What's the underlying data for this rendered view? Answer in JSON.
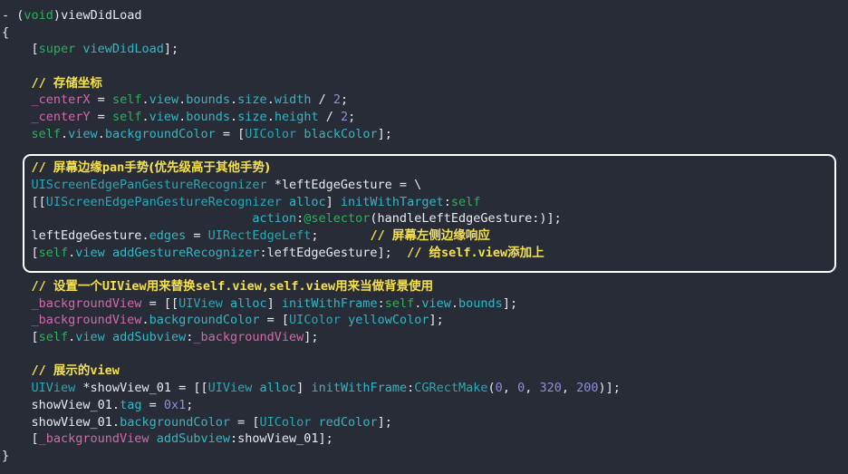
{
  "editor": {
    "language": "Objective-C",
    "background_color": "#282c36",
    "default_text_color": "#e8eaf0",
    "comment_color": "#f4e04d",
    "keyword_color": "#2fae5e",
    "type_color": "#2aa8b5",
    "property_color": "#36b5c4",
    "variable_color": "#d06aa8",
    "number_color": "#8f8ed8",
    "highlight_border_color": "#ffffff"
  },
  "code_lines": [
    {
      "id": "l1",
      "text": "- (void)viewDidLoad"
    },
    {
      "id": "l2",
      "text": "{"
    },
    {
      "id": "l3",
      "text": "    [super viewDidLoad];"
    },
    {
      "id": "l4",
      "text": ""
    },
    {
      "id": "l5",
      "text": "    // 存储坐标"
    },
    {
      "id": "l6",
      "text": "    _centerX = self.view.bounds.size.width / 2;"
    },
    {
      "id": "l7",
      "text": "    _centerY = self.view.bounds.size.height / 2;"
    },
    {
      "id": "l8",
      "text": "    self.view.backgroundColor = [UIColor blackColor];"
    },
    {
      "id": "l9",
      "text": ""
    },
    {
      "id": "l10",
      "text": "    // 屏幕边缘pan手势(优先级高于其他手势)"
    },
    {
      "id": "l11",
      "text": "    UIScreenEdgePanGestureRecognizer *leftEdgeGesture = \\"
    },
    {
      "id": "l12",
      "text": "    [[UIScreenEdgePanGestureRecognizer alloc] initWithTarget:self"
    },
    {
      "id": "l13",
      "text": "                                  action:@selector(handleLeftEdgeGesture:)];"
    },
    {
      "id": "l14",
      "text": "    leftEdgeGesture.edges = UIRectEdgeLeft;       // 屏幕左侧边缘响应"
    },
    {
      "id": "l15",
      "text": "    [self.view addGestureRecognizer:leftEdgeGesture];  // 给self.view添加上"
    },
    {
      "id": "l16",
      "text": ""
    },
    {
      "id": "l17",
      "text": "    // 设置一个UIView用来替换self.view,self.view用来当做背景使用"
    },
    {
      "id": "l18",
      "text": "    _backgroundView = [[UIView alloc] initWithFrame:self.view.bounds];"
    },
    {
      "id": "l19",
      "text": "    _backgroundView.backgroundColor = [UIColor yellowColor];"
    },
    {
      "id": "l20",
      "text": "    [self.view addSubview:_backgroundView];"
    },
    {
      "id": "l21",
      "text": ""
    },
    {
      "id": "l22",
      "text": "    // 展示的view"
    },
    {
      "id": "l23",
      "text": "    UIView *showView_01 = [[UIView alloc] initWithFrame:CGRectMake(0, 0, 320, 200)];"
    },
    {
      "id": "l24",
      "text": "    showView_01.tag = 0x1;"
    },
    {
      "id": "l25",
      "text": "    showView_01.backgroundColor = [UIColor redColor];"
    },
    {
      "id": "l26",
      "text": "    [_backgroundView addSubview:showView_01];"
    },
    {
      "id": "l27",
      "text": "}"
    }
  ],
  "tokens": {
    "l1": [
      {
        "t": "- ",
        "c": "punct"
      },
      {
        "t": "(",
        "c": "punct"
      },
      {
        "t": "void",
        "c": "kw"
      },
      {
        "t": ")",
        "c": "punct"
      },
      {
        "t": "viewDidLoad",
        "c": "plain"
      }
    ],
    "l2": [
      {
        "t": "{",
        "c": "punct"
      }
    ],
    "l3": [
      {
        "t": "    [",
        "c": "punct"
      },
      {
        "t": "super",
        "c": "kw"
      },
      {
        "t": " ",
        "c": "plain"
      },
      {
        "t": "viewDidLoad",
        "c": "prop"
      },
      {
        "t": "];",
        "c": "punct"
      }
    ],
    "l5": [
      {
        "t": "    // ",
        "c": "comment"
      },
      {
        "t": "存储坐标",
        "c": "comment cjk"
      }
    ],
    "l6": [
      {
        "t": "    ",
        "c": "plain"
      },
      {
        "t": "_centerX",
        "c": "var"
      },
      {
        "t": " = ",
        "c": "punct"
      },
      {
        "t": "self",
        "c": "selfkw"
      },
      {
        "t": ".",
        "c": "punct"
      },
      {
        "t": "view",
        "c": "prop"
      },
      {
        "t": ".",
        "c": "punct"
      },
      {
        "t": "bounds",
        "c": "prop"
      },
      {
        "t": ".",
        "c": "punct"
      },
      {
        "t": "size",
        "c": "prop"
      },
      {
        "t": ".",
        "c": "punct"
      },
      {
        "t": "width",
        "c": "prop"
      },
      {
        "t": " / ",
        "c": "punct"
      },
      {
        "t": "2",
        "c": "num"
      },
      {
        "t": ";",
        "c": "punct"
      }
    ],
    "l7": [
      {
        "t": "    ",
        "c": "plain"
      },
      {
        "t": "_centerY",
        "c": "var"
      },
      {
        "t": " = ",
        "c": "punct"
      },
      {
        "t": "self",
        "c": "selfkw"
      },
      {
        "t": ".",
        "c": "punct"
      },
      {
        "t": "view",
        "c": "prop"
      },
      {
        "t": ".",
        "c": "punct"
      },
      {
        "t": "bounds",
        "c": "prop"
      },
      {
        "t": ".",
        "c": "punct"
      },
      {
        "t": "size",
        "c": "prop"
      },
      {
        "t": ".",
        "c": "punct"
      },
      {
        "t": "height",
        "c": "prop"
      },
      {
        "t": " / ",
        "c": "punct"
      },
      {
        "t": "2",
        "c": "num"
      },
      {
        "t": ";",
        "c": "punct"
      }
    ],
    "l8": [
      {
        "t": "    ",
        "c": "plain"
      },
      {
        "t": "self",
        "c": "selfkw"
      },
      {
        "t": ".",
        "c": "punct"
      },
      {
        "t": "view",
        "c": "prop"
      },
      {
        "t": ".",
        "c": "punct"
      },
      {
        "t": "backgroundColor",
        "c": "prop"
      },
      {
        "t": " = [",
        "c": "punct"
      },
      {
        "t": "UIColor",
        "c": "type"
      },
      {
        "t": " ",
        "c": "plain"
      },
      {
        "t": "blackColor",
        "c": "prop"
      },
      {
        "t": "];",
        "c": "punct"
      }
    ],
    "l10": [
      {
        "t": "    // ",
        "c": "comment"
      },
      {
        "t": "屏幕边缘",
        "c": "comment cjk"
      },
      {
        "t": "pan",
        "c": "comment"
      },
      {
        "t": "手势",
        "c": "comment cjk"
      },
      {
        "t": "(优先级高于其他手势)",
        "c": "comment cjk"
      }
    ],
    "l11": [
      {
        "t": "    ",
        "c": "plain"
      },
      {
        "t": "UIScreenEdgePanGestureRecognizer",
        "c": "type"
      },
      {
        "t": " *leftEdgeGesture = \\",
        "c": "plain"
      }
    ],
    "l12": [
      {
        "t": "    [[",
        "c": "punct"
      },
      {
        "t": "UIScreenEdgePanGestureRecognizer",
        "c": "type"
      },
      {
        "t": " ",
        "c": "plain"
      },
      {
        "t": "alloc",
        "c": "prop"
      },
      {
        "t": "] ",
        "c": "punct"
      },
      {
        "t": "initWithTarget",
        "c": "prop"
      },
      {
        "t": ":",
        "c": "punct"
      },
      {
        "t": "self",
        "c": "selfkw"
      }
    ],
    "l13": [
      {
        "t": "                                  ",
        "c": "plain"
      },
      {
        "t": "action",
        "c": "prop"
      },
      {
        "t": ":",
        "c": "punct"
      },
      {
        "t": "@selector",
        "c": "macro"
      },
      {
        "t": "(handleLeftEdgeGesture:)];",
        "c": "plain"
      }
    ],
    "l14": [
      {
        "t": "    leftEdgeGesture",
        "c": "plain"
      },
      {
        "t": ".",
        "c": "punct"
      },
      {
        "t": "edges",
        "c": "prop"
      },
      {
        "t": " = ",
        "c": "punct"
      },
      {
        "t": "UIRectEdgeLeft",
        "c": "type"
      },
      {
        "t": ";",
        "c": "punct"
      },
      {
        "t": "       // ",
        "c": "comment"
      },
      {
        "t": "屏幕左侧边缘响应",
        "c": "comment cjk"
      }
    ],
    "l15": [
      {
        "t": "    [",
        "c": "punct"
      },
      {
        "t": "self",
        "c": "selfkw"
      },
      {
        "t": ".",
        "c": "punct"
      },
      {
        "t": "view",
        "c": "prop"
      },
      {
        "t": " ",
        "c": "plain"
      },
      {
        "t": "addGestureRecognizer",
        "c": "prop"
      },
      {
        "t": ":leftEdgeGesture];",
        "c": "plain"
      },
      {
        "t": "  // ",
        "c": "comment"
      },
      {
        "t": "给",
        "c": "comment cjk"
      },
      {
        "t": "self.view",
        "c": "comment"
      },
      {
        "t": "添加上",
        "c": "comment cjk"
      }
    ],
    "l17": [
      {
        "t": "    // ",
        "c": "comment"
      },
      {
        "t": "设置一个",
        "c": "comment cjk"
      },
      {
        "t": "UIView",
        "c": "comment"
      },
      {
        "t": "用来替换",
        "c": "comment cjk"
      },
      {
        "t": "self.view,self.view",
        "c": "comment"
      },
      {
        "t": "用来当做背景使用",
        "c": "comment cjk"
      }
    ],
    "l18": [
      {
        "t": "    ",
        "c": "plain"
      },
      {
        "t": "_backgroundView",
        "c": "var"
      },
      {
        "t": " = [[",
        "c": "punct"
      },
      {
        "t": "UIView",
        "c": "type"
      },
      {
        "t": " ",
        "c": "plain"
      },
      {
        "t": "alloc",
        "c": "prop"
      },
      {
        "t": "] ",
        "c": "punct"
      },
      {
        "t": "initWithFrame",
        "c": "prop"
      },
      {
        "t": ":",
        "c": "punct"
      },
      {
        "t": "self",
        "c": "selfkw"
      },
      {
        "t": ".",
        "c": "punct"
      },
      {
        "t": "view",
        "c": "prop"
      },
      {
        "t": ".",
        "c": "punct"
      },
      {
        "t": "bounds",
        "c": "prop"
      },
      {
        "t": "];",
        "c": "punct"
      }
    ],
    "l19": [
      {
        "t": "    ",
        "c": "plain"
      },
      {
        "t": "_backgroundView",
        "c": "var"
      },
      {
        "t": ".",
        "c": "punct"
      },
      {
        "t": "backgroundColor",
        "c": "prop"
      },
      {
        "t": " = [",
        "c": "punct"
      },
      {
        "t": "UIColor",
        "c": "type"
      },
      {
        "t": " ",
        "c": "plain"
      },
      {
        "t": "yellowColor",
        "c": "prop"
      },
      {
        "t": "];",
        "c": "punct"
      }
    ],
    "l20": [
      {
        "t": "    [",
        "c": "punct"
      },
      {
        "t": "self",
        "c": "selfkw"
      },
      {
        "t": ".",
        "c": "punct"
      },
      {
        "t": "view",
        "c": "prop"
      },
      {
        "t": " ",
        "c": "plain"
      },
      {
        "t": "addSubview",
        "c": "prop"
      },
      {
        "t": ":",
        "c": "punct"
      },
      {
        "t": "_backgroundView",
        "c": "var"
      },
      {
        "t": "];",
        "c": "punct"
      }
    ],
    "l22": [
      {
        "t": "    // ",
        "c": "comment"
      },
      {
        "t": "展示的",
        "c": "comment cjk"
      },
      {
        "t": "view",
        "c": "comment"
      }
    ],
    "l23": [
      {
        "t": "    ",
        "c": "plain"
      },
      {
        "t": "UIView",
        "c": "type"
      },
      {
        "t": " *showView_01 = [[",
        "c": "plain"
      },
      {
        "t": "UIView",
        "c": "type"
      },
      {
        "t": " ",
        "c": "plain"
      },
      {
        "t": "alloc",
        "c": "prop"
      },
      {
        "t": "] ",
        "c": "punct"
      },
      {
        "t": "initWithFrame",
        "c": "prop"
      },
      {
        "t": ":",
        "c": "punct"
      },
      {
        "t": "CGRectMake",
        "c": "type"
      },
      {
        "t": "(",
        "c": "punct"
      },
      {
        "t": "0",
        "c": "num"
      },
      {
        "t": ", ",
        "c": "punct"
      },
      {
        "t": "0",
        "c": "num"
      },
      {
        "t": ", ",
        "c": "punct"
      },
      {
        "t": "320",
        "c": "num"
      },
      {
        "t": ", ",
        "c": "punct"
      },
      {
        "t": "200",
        "c": "num"
      },
      {
        "t": ")];",
        "c": "punct"
      }
    ],
    "l24": [
      {
        "t": "    showView_01",
        "c": "plain"
      },
      {
        "t": ".",
        "c": "punct"
      },
      {
        "t": "tag",
        "c": "prop"
      },
      {
        "t": " = ",
        "c": "punct"
      },
      {
        "t": "0x1",
        "c": "num"
      },
      {
        "t": ";",
        "c": "punct"
      }
    ],
    "l25": [
      {
        "t": "    showView_01",
        "c": "plain"
      },
      {
        "t": ".",
        "c": "punct"
      },
      {
        "t": "backgroundColor",
        "c": "prop"
      },
      {
        "t": " = [",
        "c": "punct"
      },
      {
        "t": "UIColor",
        "c": "type"
      },
      {
        "t": " ",
        "c": "plain"
      },
      {
        "t": "redColor",
        "c": "prop"
      },
      {
        "t": "];",
        "c": "punct"
      }
    ],
    "l26": [
      {
        "t": "    [",
        "c": "punct"
      },
      {
        "t": "_backgroundView",
        "c": "var"
      },
      {
        "t": " ",
        "c": "plain"
      },
      {
        "t": "addSubview",
        "c": "prop"
      },
      {
        "t": ":showView_01];",
        "c": "plain"
      }
    ],
    "l27": [
      {
        "t": "}",
        "c": "punct"
      }
    ]
  },
  "highlight_box": {
    "label": "screen-edge-pan-gesture-block",
    "covers_lines": [
      "l10",
      "l11",
      "l12",
      "l13",
      "l14",
      "l15"
    ]
  }
}
